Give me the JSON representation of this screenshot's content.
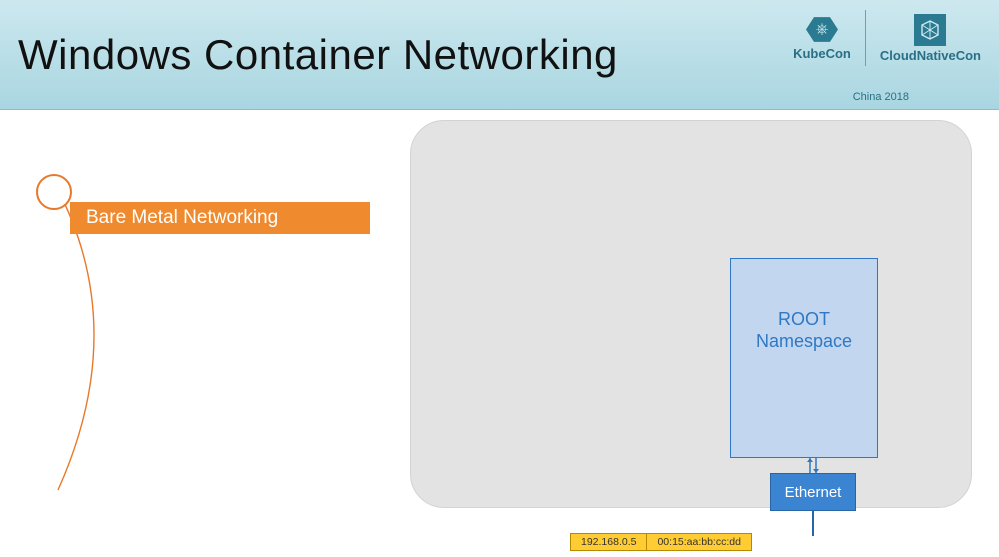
{
  "header": {
    "title": "Windows Container Networking",
    "logos": {
      "left_label": "KubeCon",
      "right_label": "CloudNativeCon",
      "event_sub": "China 2018"
    }
  },
  "subtitle": "Bare Metal Networking",
  "diagram": {
    "root_ns_line1": "ROOT",
    "root_ns_line2": "Namespace",
    "ethernet_label": "Ethernet",
    "ip": "192.168.0.5",
    "mac": "00:15:aa:bb:cc:dd"
  },
  "colors": {
    "accent_orange": "#ef8a2e",
    "panel_gray": "#e3e3e3",
    "box_blue_fill": "#c2d6f0",
    "box_blue_border": "#2f78c4",
    "eth_blue": "#3a84d2",
    "info_yellow": "#ffcc33",
    "header_teal": "#b7dde6"
  }
}
